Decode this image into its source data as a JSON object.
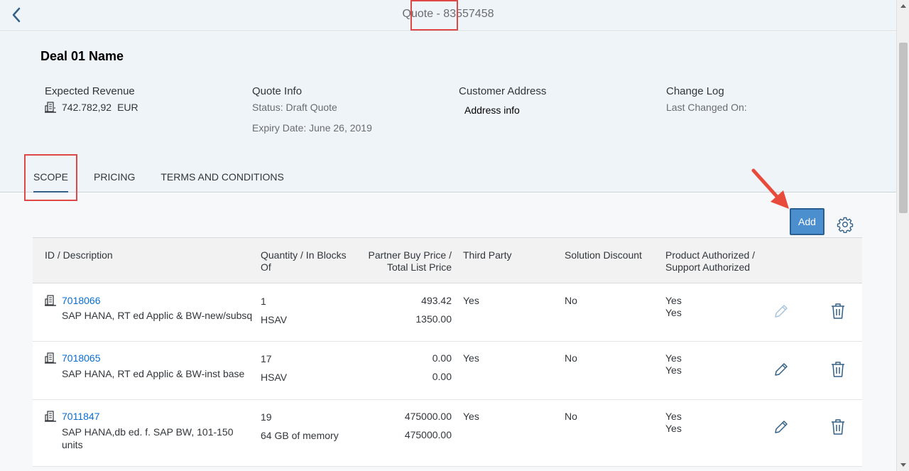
{
  "topbar": {
    "title": "Quote - 83557458"
  },
  "header": {
    "deal_name": "Deal 01 Name",
    "expected_revenue": {
      "label": "Expected Revenue",
      "amount": "742.782,92",
      "currency": "EUR"
    },
    "quote_info": {
      "label": "Quote Info",
      "status": "Status: Draft Quote",
      "expiry": "Expiry Date: June 26, 2019"
    },
    "customer_address": {
      "label": "Customer Address",
      "value": "Address info"
    },
    "change_log": {
      "label": "Change Log",
      "last_changed": "Last Changed On:"
    }
  },
  "tabs": [
    {
      "label": "SCOPE",
      "active": true
    },
    {
      "label": "PRICING",
      "active": false
    },
    {
      "label": "TERMS AND CONDITIONS",
      "active": false
    }
  ],
  "toolbar": {
    "add_label": "Add"
  },
  "table": {
    "columns": {
      "id_desc": "ID / Description",
      "qty": [
        "Quantity / In Blocks",
        "Of"
      ],
      "price": [
        "Partner Buy Price /",
        "Total List Price"
      ],
      "third_party": "Third Party",
      "discount": "Solution Discount",
      "authorized": [
        "Product Authorized /",
        "Support Authorized"
      ]
    },
    "rows": [
      {
        "id": "7018066",
        "desc": [
          "SAP HANA, RT ed Applic & BW-new/subsq"
        ],
        "qty": "1",
        "blocks": "HSAV",
        "buy_price": "493.42",
        "list_price": "1350.00",
        "third_party": "Yes",
        "discount": "No",
        "product_auth": "Yes",
        "support_auth": "Yes"
      },
      {
        "id": "7018065",
        "desc": [
          "SAP HANA, RT ed Applic & BW-inst base"
        ],
        "qty": "17",
        "blocks": "HSAV",
        "buy_price": "0.00",
        "list_price": "0.00",
        "third_party": "Yes",
        "discount": "No",
        "product_auth": "Yes",
        "support_auth": "Yes"
      },
      {
        "id": "7011847",
        "desc": [
          "SAP HANA,db ed. f. SAP BW, 101-150",
          "units"
        ],
        "qty": "19",
        "blocks": "64 GB of memory",
        "buy_price": "475000.00",
        "list_price": "475000.00",
        "third_party": "Yes",
        "discount": "No",
        "product_auth": "Yes",
        "support_auth": "Yes"
      }
    ]
  },
  "colors": {
    "accent": "#0a6ed1",
    "header_bg": "#eff4f9",
    "add_button": "#4c8fcf",
    "highlight": "#e04848",
    "arrow": "#e84a3c"
  }
}
